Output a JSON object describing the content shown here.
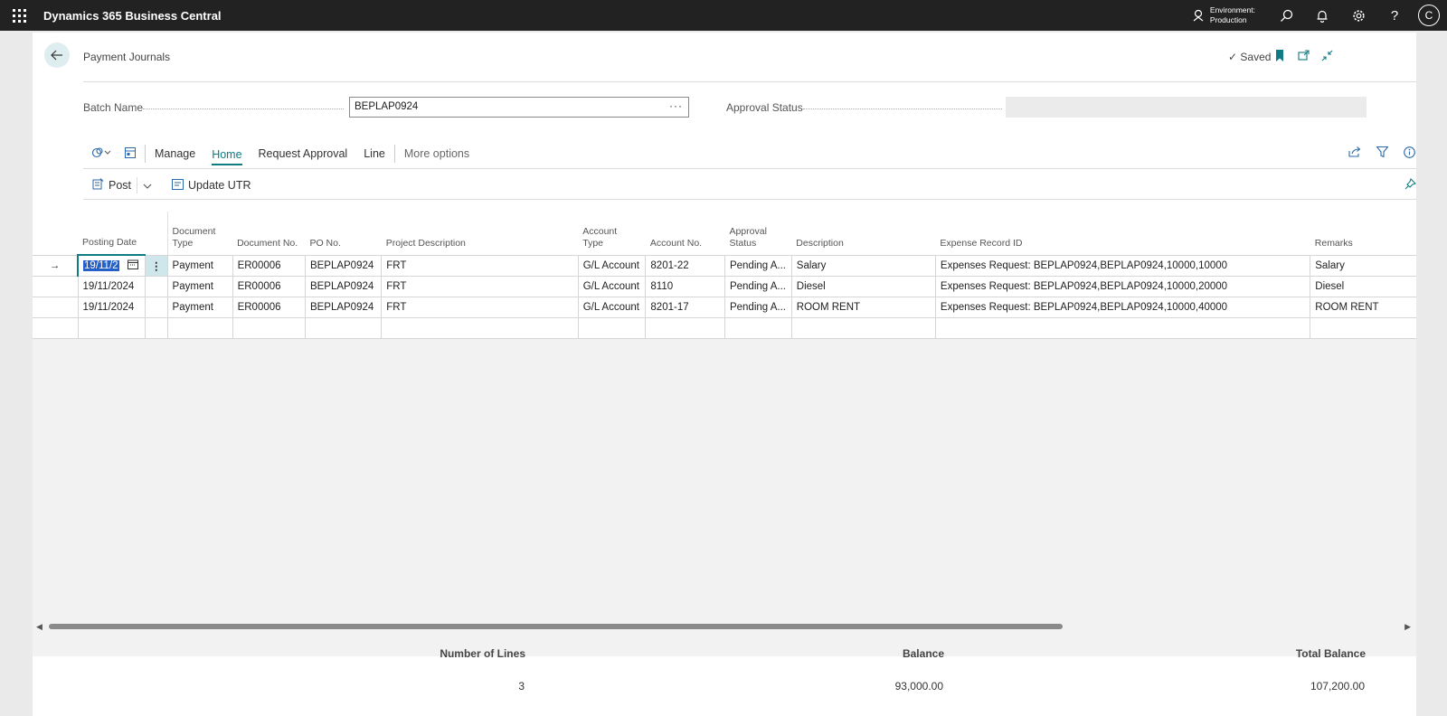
{
  "app": {
    "title": "Dynamics 365 Business Central"
  },
  "topbar": {
    "environment_label": "Environment:",
    "environment_value": "Production",
    "avatar_initial": "C"
  },
  "page": {
    "caption": "Payment Journals",
    "saved_label": "Saved"
  },
  "fields": {
    "batch_name_label": "Batch Name",
    "batch_name_value": "BEPLAP0924",
    "approval_status_label": "Approval Status",
    "approval_status_value": ""
  },
  "actionbar": {
    "menus": [
      "Manage",
      "Home",
      "Request Approval",
      "Line",
      "More options"
    ],
    "active": "Home"
  },
  "home_actions": {
    "post_label": "Post",
    "update_utr_label": "Update UTR"
  },
  "table": {
    "columns": {
      "posting_date": "Posting Date",
      "document_type": [
        "Document",
        "Type"
      ],
      "document_no": "Document No.",
      "po_no": "PO No.",
      "project_description": "Project Description",
      "account_type": [
        "Account",
        "Type"
      ],
      "account_no": "Account No.",
      "approval_status": [
        "Approval",
        "Status"
      ],
      "description": "Description",
      "expense_record_id": "Expense Record ID",
      "remarks": "Remarks"
    },
    "rows": [
      {
        "posting_date": "19/11/2",
        "document_type": "Payment",
        "document_no": "ER00006",
        "po_no": "BEPLAP0924",
        "project_description": "FRT",
        "account_type": "G/L Account",
        "account_no": "8201-22",
        "approval_status": "Pending A...",
        "description": "Salary",
        "expense_record_id": "Expenses Request: BEPLAP0924,BEPLAP0924,10000,10000",
        "remarks": "Salary"
      },
      {
        "posting_date": "19/11/2024",
        "document_type": "Payment",
        "document_no": "ER00006",
        "po_no": "BEPLAP0924",
        "project_description": "FRT",
        "account_type": "G/L Account",
        "account_no": "8110",
        "approval_status": "Pending A...",
        "description": "Diesel",
        "expense_record_id": "Expenses Request: BEPLAP0924,BEPLAP0924,10000,20000",
        "remarks": "Diesel"
      },
      {
        "posting_date": "19/11/2024",
        "document_type": "Payment",
        "document_no": "ER00006",
        "po_no": "BEPLAP0924",
        "project_description": "FRT",
        "account_type": "G/L Account",
        "account_no": "8201-17",
        "approval_status": "Pending A...",
        "description": "ROOM RENT",
        "expense_record_id": "Expenses Request: BEPLAP0924,BEPLAP0924,10000,40000",
        "remarks": "ROOM RENT"
      }
    ]
  },
  "totals": {
    "number_of_lines_label": "Number of Lines",
    "number_of_lines": "3",
    "balance_label": "Balance",
    "balance": "93,000.00",
    "total_balance_label": "Total Balance",
    "total_balance": "107,200.00"
  },
  "colors": {
    "accent": "#0f7b83",
    "topbar": "#222222",
    "selection": "#2560c9"
  },
  "icons": [
    "waffle-icon",
    "environment-icon",
    "search-icon",
    "bell-icon",
    "gear-icon",
    "help-icon",
    "back-arrow-icon",
    "checkmark-icon",
    "bookmark-icon",
    "open-new-icon",
    "collapse-icon",
    "copilot-icon",
    "page-icon",
    "share-icon",
    "filter-icon",
    "info-icon",
    "post-icon",
    "update-utr-icon",
    "pin-icon",
    "row-arrow-icon",
    "calendar-icon",
    "row-menu-icon"
  ]
}
